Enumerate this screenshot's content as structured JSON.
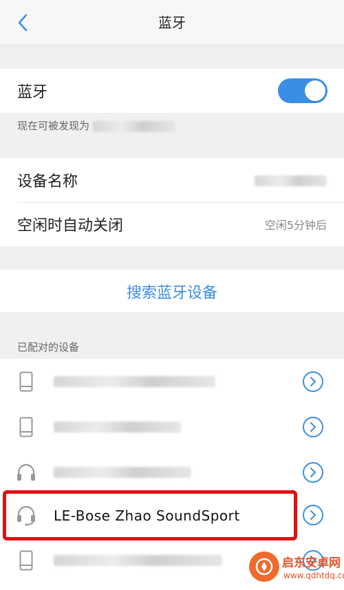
{
  "header": {
    "title": "蓝牙"
  },
  "bluetooth": {
    "label": "蓝牙",
    "enabled": true,
    "discoverable_prefix": "现在可被发现为"
  },
  "settings": {
    "device_name_label": "设备名称",
    "auto_off_label": "空闲时自动关闭",
    "auto_off_value": "空闲5分钟后"
  },
  "search": {
    "label": "搜索蓝牙设备"
  },
  "paired": {
    "section_label": "已配对的设备",
    "devices": [
      {
        "type": "phone-icon",
        "name": ""
      },
      {
        "type": "phone-icon",
        "name": ""
      },
      {
        "type": "headphones-icon",
        "name": ""
      },
      {
        "type": "headphones-icon",
        "name": "LE-Bose Zhao SoundSport"
      },
      {
        "type": "phone-icon",
        "name": ""
      }
    ]
  },
  "watermark": {
    "title": "启东安卓网",
    "url": "www.qdhtdq.com"
  },
  "colors": {
    "accent": "#3a8ee6",
    "highlight": "#e01010",
    "watermark": "#e8512a"
  }
}
